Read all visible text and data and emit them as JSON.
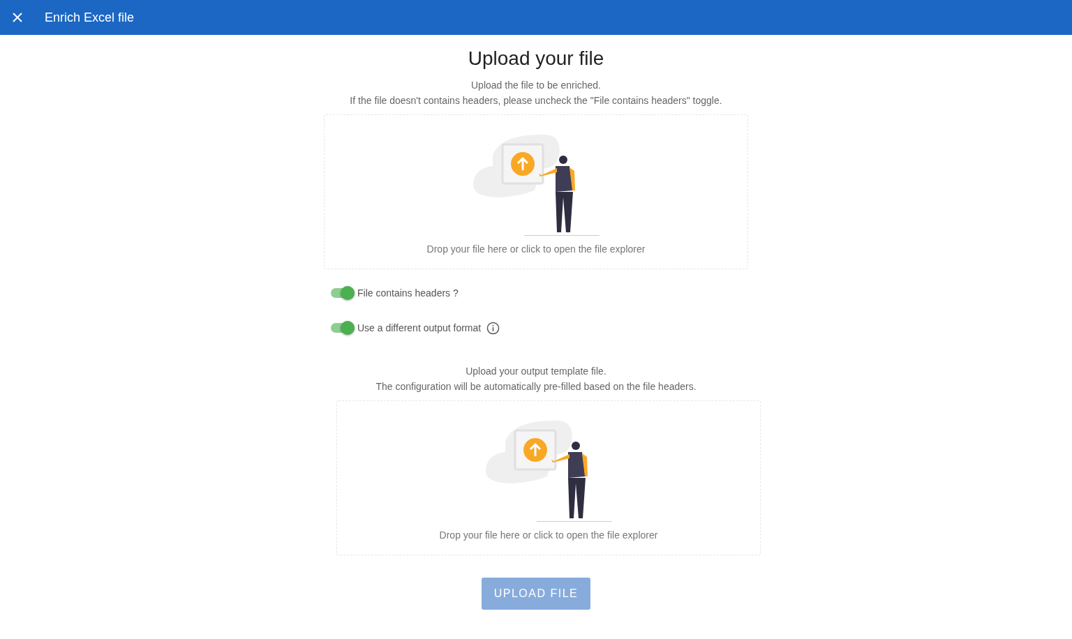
{
  "header": {
    "title": "Enrich Excel file"
  },
  "title": "Upload your file",
  "intro": [
    "Upload the file to be enriched.",
    "If the file doesn't contains headers, please uncheck the \"File contains headers\" toggle."
  ],
  "input_dropzone": {
    "text": "Drop your file here or click to open the file explorer"
  },
  "toggles": [
    {
      "label": "File contains headers ?",
      "on": true,
      "info": false
    },
    {
      "label": "Use a different output format",
      "on": true,
      "info": true
    }
  ],
  "template_intro": [
    "Upload your output template file.",
    "The configuration will be automatically pre-filled based on the file headers."
  ],
  "template_dropzone": {
    "text": "Drop your file here or click to open the file explorer"
  },
  "upload_button": {
    "label": "UPLOAD FILE",
    "disabled": true
  }
}
